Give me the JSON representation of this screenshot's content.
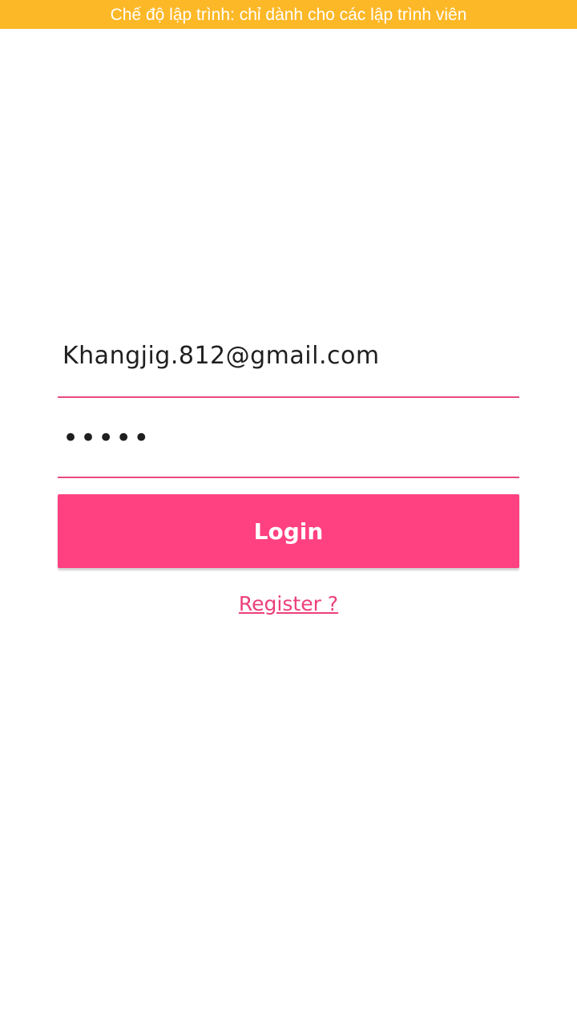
{
  "status_banner": {
    "text": "Chế độ lập trình: chỉ dành cho các lập trình viên"
  },
  "login_form": {
    "email_value": "Khangjig.812@gmail.com",
    "password_value": "12345",
    "login_label": "Login",
    "register_label": "Register ?"
  },
  "colors": {
    "banner": "#FDB827",
    "accent": "#FF4081",
    "underline": "#E84A7F"
  }
}
